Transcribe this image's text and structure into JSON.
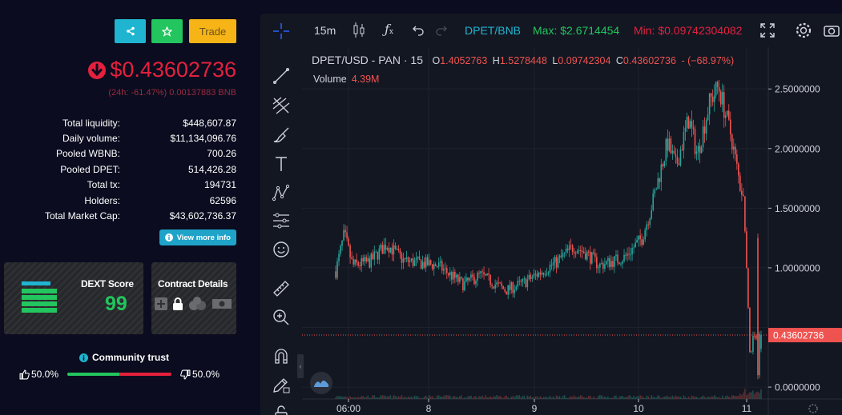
{
  "colors": {
    "accent_cyan": "#1fb5d1",
    "green": "#22c55e",
    "red": "#e5203e",
    "trade_yellow": "#f6b417",
    "candle_up": "#26a69a",
    "candle_down": "#ef5350"
  },
  "actions": {
    "share_icon": "share-icon",
    "star_icon": "star-icon",
    "trade_label": "Trade"
  },
  "token": {
    "price": "$0.43602736",
    "change_line": "(24h: -61.47%) 0.00137883 BNB"
  },
  "stats": [
    {
      "label": "Total liquidity:",
      "value": "$448,607.87"
    },
    {
      "label": "Daily volume:",
      "value": "$11,134,096.76"
    },
    {
      "label": "Pooled WBNB:",
      "value": "700.26"
    },
    {
      "label": "Pooled DPET:",
      "value": "514,426.28"
    },
    {
      "label": "Total tx:",
      "value": "194731"
    },
    {
      "label": "Holders:",
      "value": "62596"
    },
    {
      "label": "Total Market Cap:",
      "value": "$43,602,736.37"
    }
  ],
  "view_more": "View more info",
  "dext": {
    "title": "DEXT Score",
    "score": "99"
  },
  "contract": {
    "title": "Contract Details"
  },
  "community": {
    "title": "Community trust",
    "up": "50.0%",
    "down": "50.0%",
    "up_fraction": 0.5
  },
  "toolbar": {
    "interval": "15m",
    "pair": "DPET/BNB",
    "max": "Max: $2.6714454",
    "min": "Min: $0.09742304082"
  },
  "legend": {
    "symbol": "DPET/USD - PAN · 15",
    "o_label": "O",
    "o": "1.4052763",
    "h_label": "H",
    "h": "1.5278448",
    "l_label": "L",
    "l": "0.09742304",
    "c_label": "C",
    "c": "0.43602736",
    "chg": "- (−68.97%)",
    "volume_label": "Volume",
    "volume": "4.39M"
  },
  "chart_data": {
    "type": "candlestick",
    "y_ticks": [
      "2.5000000",
      "2.0000000",
      "1.5000000",
      "1.0000000",
      "0.5000000",
      "0.0000000"
    ],
    "y_tick_values": [
      2.5,
      2.0,
      1.5,
      1.0,
      0.5,
      0.0
    ],
    "x_ticks": [
      "06:00",
      "8",
      "9",
      "10",
      "11"
    ],
    "ylim": [
      -0.1,
      2.85
    ],
    "last_price": 0.43602736,
    "last_price_label": "0.43602736",
    "grid": true,
    "path": [
      [
        0,
        0.97
      ],
      [
        0.02,
        1.28
      ],
      [
        0.04,
        1.02
      ],
      [
        0.08,
        1.05
      ],
      [
        0.12,
        1.2
      ],
      [
        0.16,
        1.06
      ],
      [
        0.24,
        1.02
      ],
      [
        0.3,
        0.86
      ],
      [
        0.34,
        0.94
      ],
      [
        0.4,
        0.81
      ],
      [
        0.44,
        0.87
      ],
      [
        0.52,
        1.05
      ],
      [
        0.56,
        1.18
      ],
      [
        0.59,
        1.12
      ],
      [
        0.62,
        1.02
      ],
      [
        0.68,
        1.09
      ],
      [
        0.72,
        1.25
      ],
      [
        0.74,
        1.48
      ],
      [
        0.78,
        2.05
      ],
      [
        0.8,
        1.85
      ],
      [
        0.83,
        2.25
      ],
      [
        0.85,
        1.95
      ],
      [
        0.88,
        2.4
      ],
      [
        0.9,
        2.52
      ],
      [
        0.93,
        2.1
      ],
      [
        0.95,
        1.7
      ],
      [
        0.96,
        1.55
      ],
      [
        0.975,
        0.12
      ],
      [
        0.98,
        0.44
      ]
    ]
  }
}
